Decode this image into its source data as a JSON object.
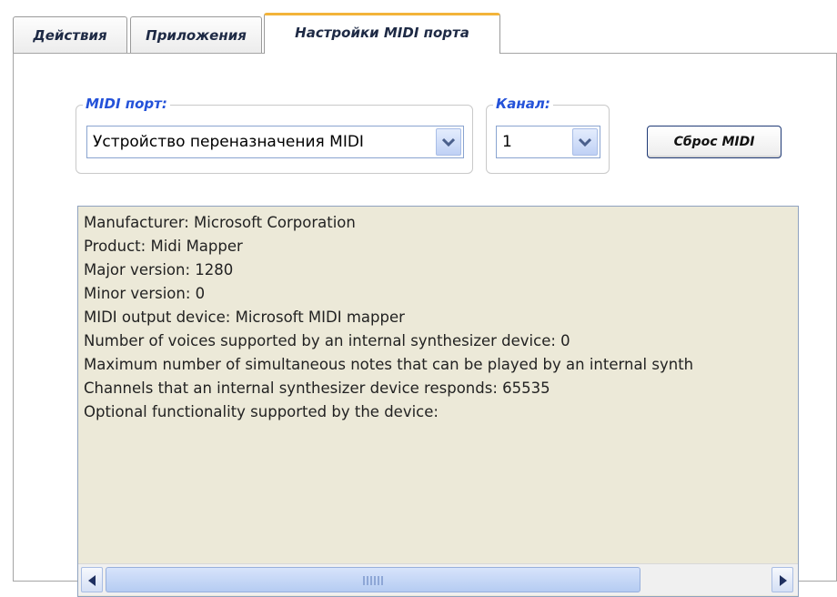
{
  "tabs": [
    {
      "label": "Действия"
    },
    {
      "label": "Приложения"
    },
    {
      "label": "Настройки MIDI порта"
    }
  ],
  "midi_port": {
    "label": "MIDI порт:",
    "value": "Устройство переназначения MIDI"
  },
  "channel": {
    "label": "Канал:",
    "value": "1"
  },
  "reset_button": "Сброс MIDI",
  "device_info": {
    "lines": [
      "Manufacturer: Microsoft Corporation",
      "Product: Midi Mapper",
      "Major version: 1280",
      "Minor version: 0",
      "MIDI output device: Microsoft MIDI mapper",
      "Number of voices supported by an internal synthesizer device: 0",
      "Maximum number of simultaneous notes that can be played by an internal synth",
      "Channels that an internal synthesizer device responds: 65535",
      "Optional functionality supported by the device:"
    ]
  },
  "scrollbar": {
    "left_icon": "arrow-left-icon",
    "right_icon": "arrow-right-icon",
    "grip_icon": "grip-icon"
  }
}
